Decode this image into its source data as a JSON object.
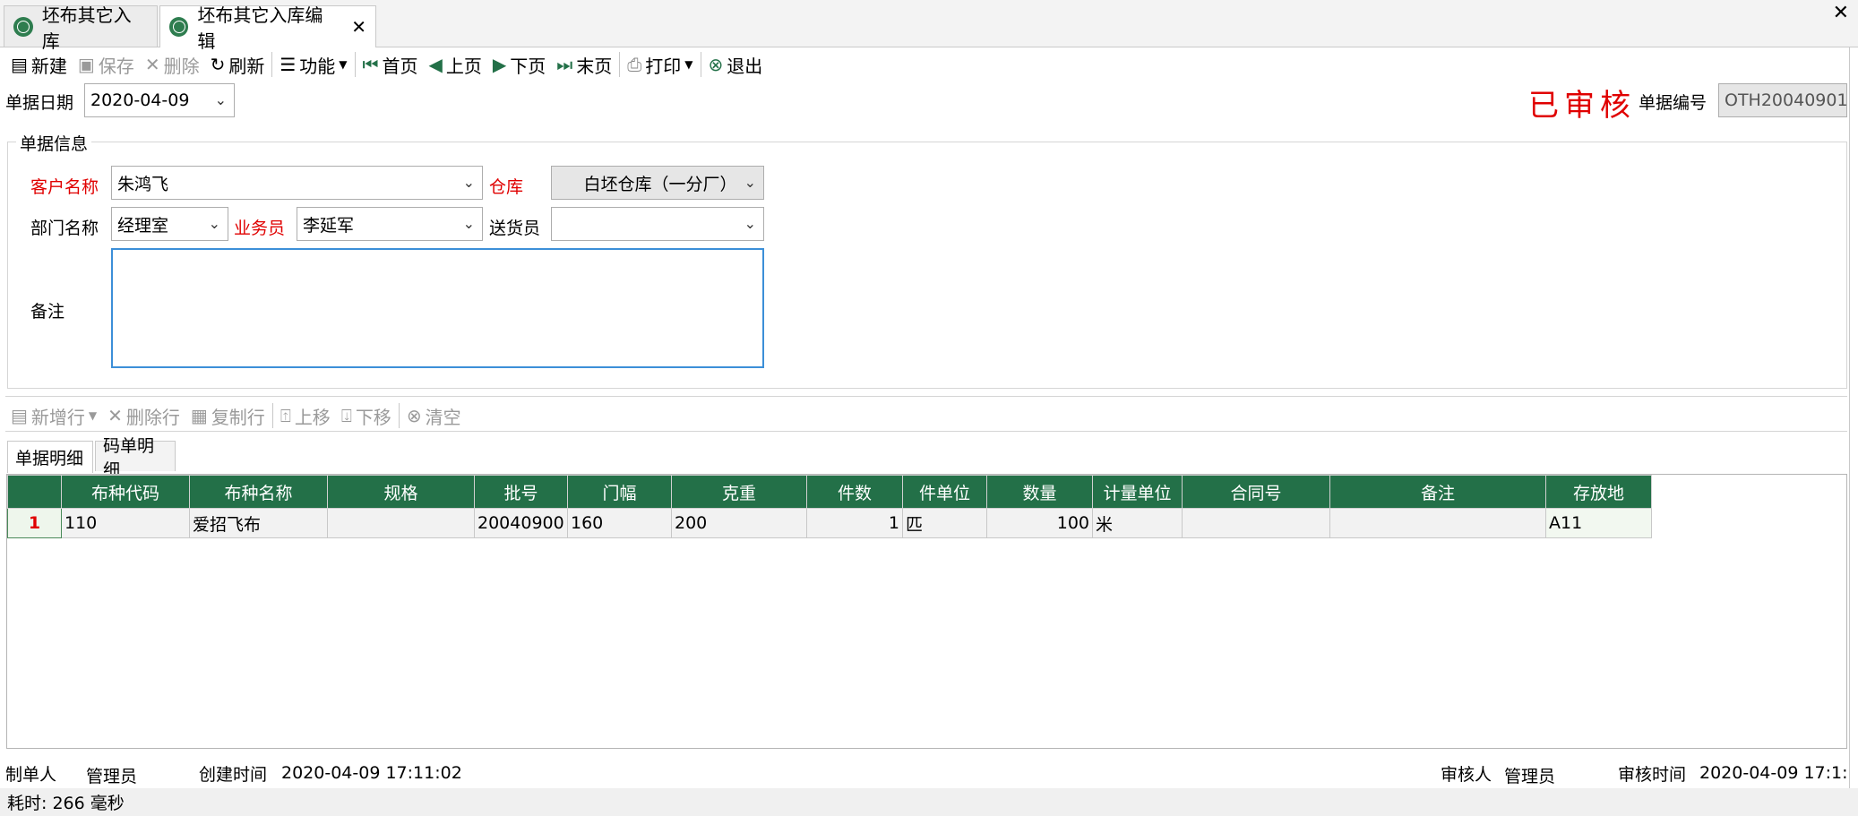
{
  "tabs": [
    {
      "label": "坯布其它入库"
    },
    {
      "label": "坯布其它入库编辑"
    }
  ],
  "toolbar": {
    "new": "新建",
    "save": "保存",
    "delete": "删除",
    "refresh": "刷新",
    "function": "功能",
    "first": "首页",
    "prev": "上页",
    "next": "下页",
    "last": "末页",
    "print": "打印",
    "exit": "退出"
  },
  "header": {
    "date_label": "单据日期",
    "date_value": "2020-04-09",
    "status_stamp": "已审核",
    "doc_no_label": "单据编号",
    "doc_no_value": "OTH20040901"
  },
  "info": {
    "group_title": "单据信息",
    "customer_label": "客户名称",
    "customer_value": "朱鸿飞",
    "warehouse_label": "仓库",
    "warehouse_value": "白坯仓库（一分厂）",
    "dept_label": "部门名称",
    "dept_value": "经理室",
    "salesman_label": "业务员",
    "salesman_value": "李延军",
    "deliverer_label": "送货员",
    "deliverer_value": "",
    "remark_label": "备注",
    "remark_value": ""
  },
  "detail_toolbar": {
    "add_row": "新增行",
    "delete_row": "删除行",
    "copy_row": "复制行",
    "move_up": "上移",
    "move_down": "下移",
    "clear": "清空"
  },
  "subtabs": [
    {
      "label": "单据明细"
    },
    {
      "label": "码单明细"
    }
  ],
  "grid": {
    "columns": [
      "布种代码",
      "布种名称",
      "规格",
      "批号",
      "门幅",
      "克重",
      "件数",
      "件单位",
      "数量",
      "计量单位",
      "合同号",
      "备注",
      "存放地"
    ],
    "rows": [
      {
        "rownum": "1",
        "cells": [
          "110",
          "爱招飞布",
          "",
          "20040900",
          "160",
          "200",
          "1",
          "匹",
          "100",
          "米",
          "",
          "",
          "A11"
        ]
      }
    ]
  },
  "footer": {
    "maker_label": "制单人",
    "maker_value": "管理员",
    "created_label": "创建时间",
    "created_value": "2020-04-09 17:11:02",
    "auditor_label": "审核人",
    "auditor_value": "管理员",
    "audit_time_label": "审核时间",
    "audit_time_value": "2020-04-09 17:1:"
  },
  "status_bar": "耗时: 266 毫秒"
}
